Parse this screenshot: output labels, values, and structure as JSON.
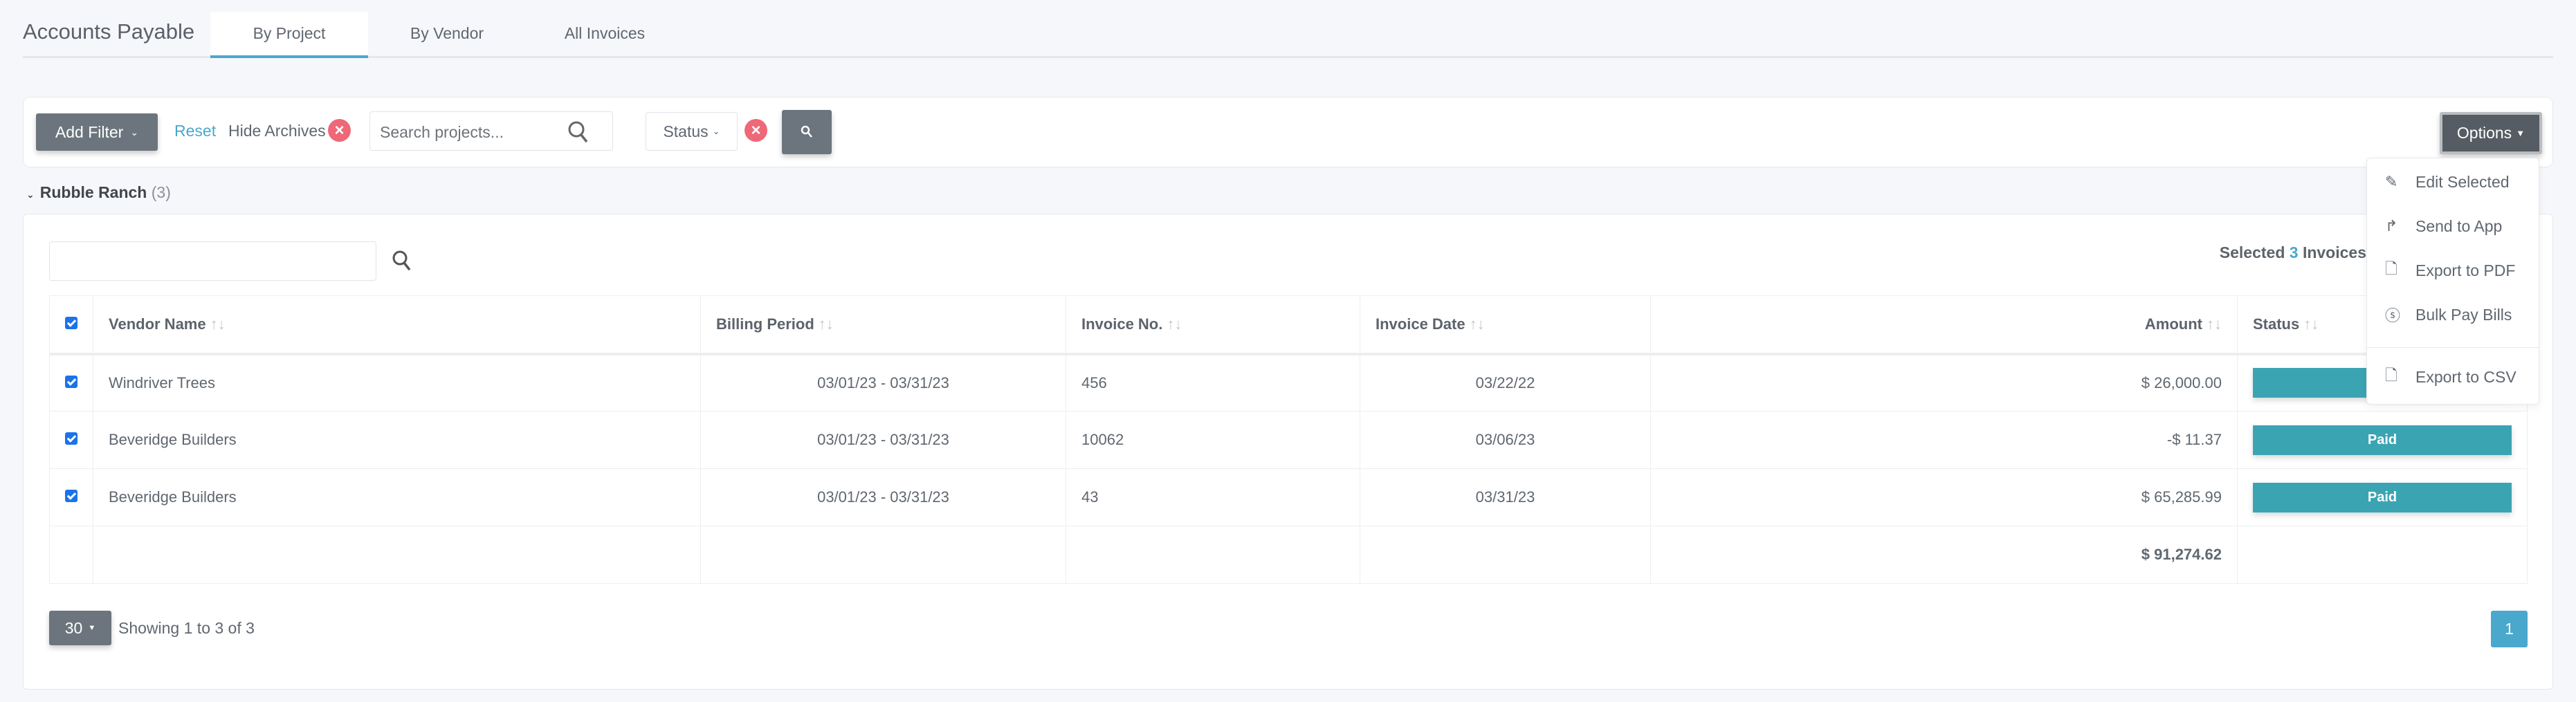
{
  "header": {
    "title": "Accounts Payable",
    "tabs": [
      {
        "label": "By Project"
      },
      {
        "label": "By Vendor"
      },
      {
        "label": "All Invoices"
      }
    ]
  },
  "filters": {
    "add_filter": "Add Filter",
    "reset": "Reset",
    "hide_archives": "Hide Archives",
    "search_placeholder": "Search projects...",
    "status": "Status",
    "options": "Options"
  },
  "options_menu": [
    {
      "label": "Edit Selected",
      "icon": "edit-icon"
    },
    {
      "label": "Send to App",
      "icon": "share-icon"
    },
    {
      "label": "Export to PDF",
      "icon": "pdf-file-icon"
    },
    {
      "label": "Bulk Pay Bills",
      "icon": "dollar-coin-icon"
    },
    {
      "label": "Export to CSV",
      "icon": "csv-file-icon"
    }
  ],
  "group": {
    "name": "Rubble Ranch",
    "count": "(3)"
  },
  "selection": {
    "prefix": "Selected",
    "count": "3",
    "suffix": "Invoices"
  },
  "table": {
    "columns": [
      "Vendor Name",
      "Billing Period",
      "Invoice No.",
      "Invoice Date",
      "Amount",
      "Status"
    ],
    "rows": [
      {
        "vendor": "Windriver Trees",
        "period": "03/01/23 - 03/31/23",
        "invoice_no": "456",
        "date": "03/22/22",
        "amount": "$ 26,000.00",
        "status": ""
      },
      {
        "vendor": "Beveridge Builders",
        "period": "03/01/23 - 03/31/23",
        "invoice_no": "10062",
        "date": "03/06/23",
        "amount": "-$ 11.37",
        "status": "Paid"
      },
      {
        "vendor": "Beveridge Builders",
        "period": "03/01/23 - 03/31/23",
        "invoice_no": "43",
        "date": "03/31/23",
        "amount": "$ 65,285.99",
        "status": "Paid"
      }
    ],
    "total": "$ 91,274.62"
  },
  "footer": {
    "page_size": "30",
    "showing": "Showing 1 to 3 of 3",
    "page": "1"
  },
  "colors": {
    "accent": "#4aa8cc",
    "status_paid": "#3ba4b2",
    "danger": "#ee6877",
    "button": "#6c757d"
  }
}
